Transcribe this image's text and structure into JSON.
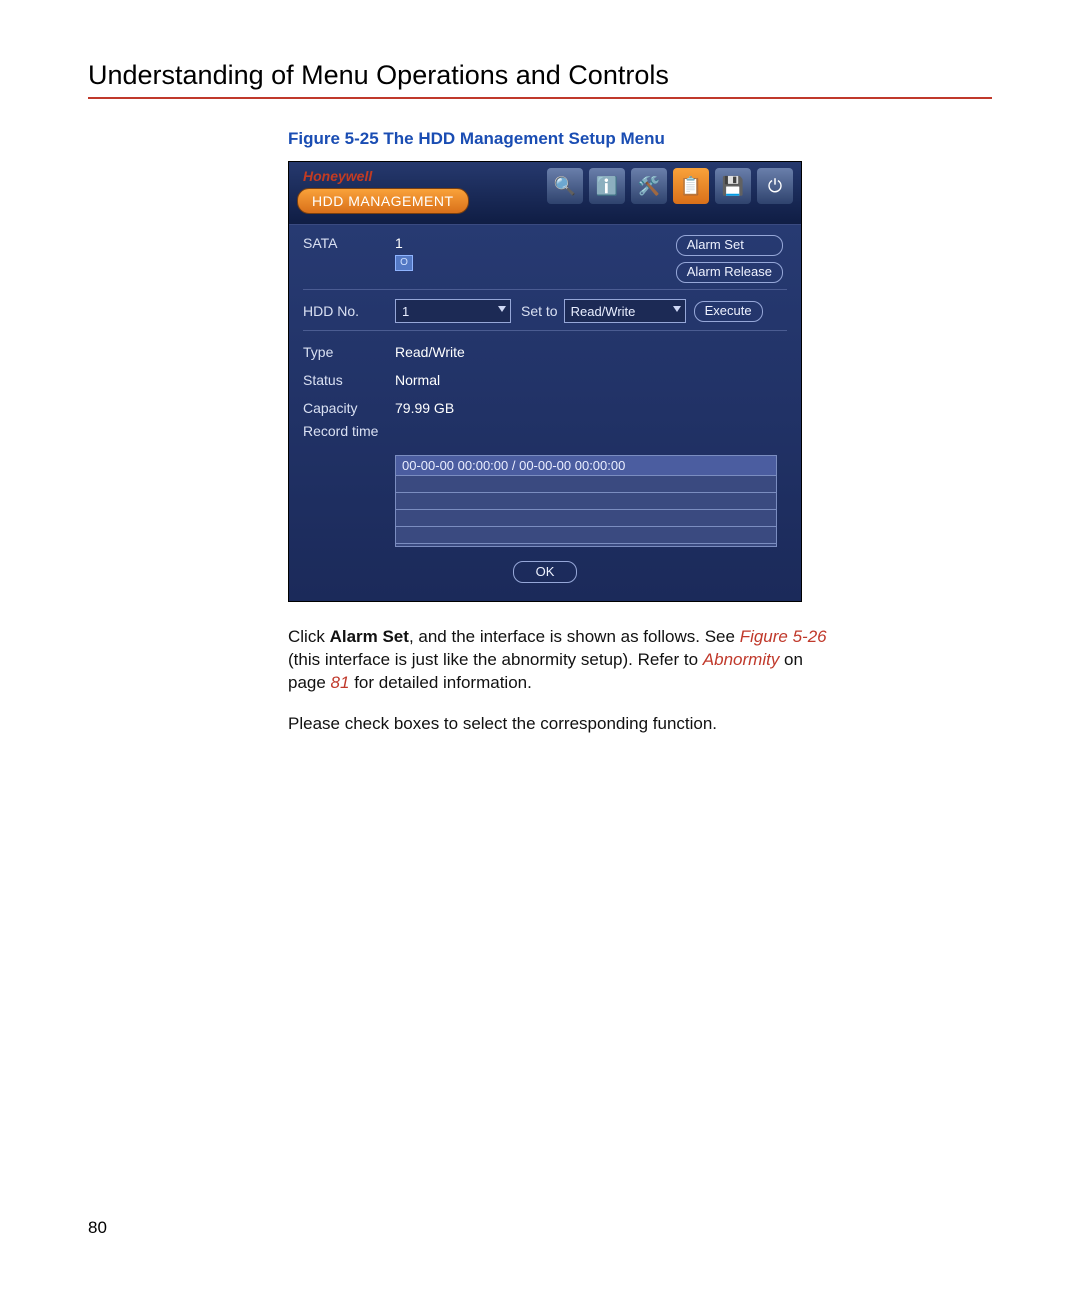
{
  "page": {
    "title": "Understanding of Menu Operations and Controls",
    "figure_caption": "Figure 5-25 The HDD Management Setup Menu",
    "page_number": "80"
  },
  "dvr": {
    "brand": "Honeywell",
    "tab_title": "HDD MANAGEMENT",
    "labels": {
      "sata": "SATA",
      "hdd_no": "HDD No.",
      "set_to": "Set to",
      "type": "Type",
      "status": "Status",
      "capacity": "Capacity",
      "record_time": "Record time"
    },
    "values": {
      "sata_slot": "1",
      "sata_indicator": "O",
      "hdd_no_selected": "1",
      "set_to_selected": "Read/Write",
      "type": "Read/Write",
      "status": "Normal",
      "capacity": "79.99 GB",
      "record_time": "00-00-00 00:00:00 / 00-00-00 00:00:00"
    },
    "buttons": {
      "alarm_set": "Alarm Set",
      "alarm_release": "Alarm Release",
      "execute": "Execute",
      "ok": "OK"
    }
  },
  "body": {
    "p1_a": "Click ",
    "p1_bold": "Alarm Set",
    "p1_b": ", and the interface is shown as follows. See ",
    "p1_ref": "Figure 5-26",
    "p1_c": " (this interface is just like the abnormity setup). Refer to ",
    "p1_ref2": "Abnormity",
    "p1_d": " on page ",
    "p1_ref3": "81",
    "p1_e": " for detailed information.",
    "p2": "Please check boxes to select the corresponding function."
  }
}
